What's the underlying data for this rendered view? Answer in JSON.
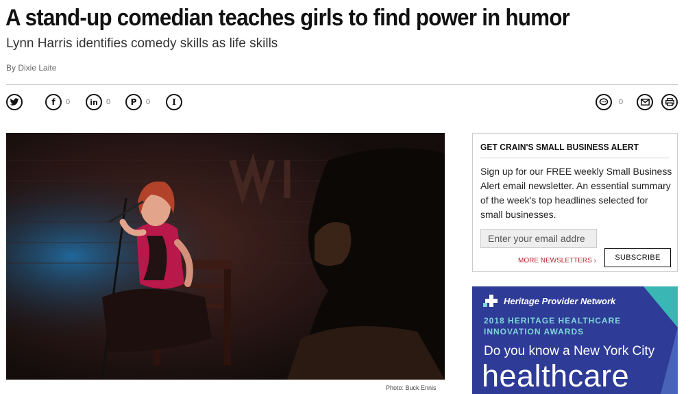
{
  "article": {
    "headline": "A stand-up comedian teaches girls to find power in humor",
    "subhead": "Lynn Harris identifies comedy skills as life skills",
    "byline": "By Dixie Laite",
    "photo_credit": "Photo: Buck Ennis"
  },
  "share": {
    "twitter_icon": "twitter-icon",
    "facebook_count": "0",
    "linkedin_count": "0",
    "pinterest_count": "0",
    "comments_count": "0"
  },
  "newsletter": {
    "title": "GET CRAIN'S SMALL BUSINESS ALERT",
    "body": "Sign up for our FREE weekly Small Business Alert email newsletter. An essential summary of the week's top headlines selected for small businesses.",
    "email_placeholder": "Enter your email addre",
    "more_label": "MORE NEWSLETTERS ›",
    "subscribe_label": "SUBSCRIBE"
  },
  "ad": {
    "brand": "Heritage Provider Network",
    "award": "2018 HERITAGE HEALTHCARE\nINNOVATION AWARDS",
    "question": "Do you know a New York City",
    "big_word": "healthcare",
    "colors": {
      "background": "#2e3b97",
      "accent": "#7fd6d8",
      "stripe": "#3ab7b5"
    }
  }
}
